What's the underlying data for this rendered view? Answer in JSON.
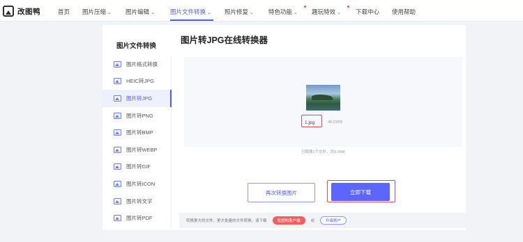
{
  "app": {
    "logo_text": "改图鸭"
  },
  "nav": {
    "items": [
      {
        "label": "首页"
      },
      {
        "label": "图片压缩",
        "caret": "⌄"
      },
      {
        "label": "图片编辑",
        "caret": "⌄"
      },
      {
        "label": "图片文件转换",
        "caret": "⌄"
      },
      {
        "label": "照片修复",
        "caret": "⌄"
      },
      {
        "label": "特色功能",
        "caret": "⌄"
      },
      {
        "label": "趣玩特效",
        "caret": "⌄"
      },
      {
        "label": "下载中心"
      },
      {
        "label": "使用帮助"
      }
    ],
    "active_index": 3
  },
  "sidebar": {
    "title": "图片文件转换",
    "items": [
      {
        "label": "图片格式转换",
        "icon": "image-icon"
      },
      {
        "label": "HEIC转JPG",
        "icon": "image-icon"
      },
      {
        "label": "图片转JPG",
        "icon": "image-icon"
      },
      {
        "label": "图片转PNG",
        "icon": "image-icon"
      },
      {
        "label": "图片转BMP",
        "icon": "image-icon"
      },
      {
        "label": "图片转WEBP",
        "icon": "image-icon"
      },
      {
        "label": "图片转GIF",
        "icon": "image-icon"
      },
      {
        "label": "图片转ICON",
        "icon": "image-icon"
      },
      {
        "label": "图片转文字",
        "icon": "image-icon"
      },
      {
        "label": "图片转PDF",
        "icon": "image-icon"
      }
    ],
    "active_index": 2
  },
  "main": {
    "title": "图片转JPG在线转换器",
    "file": {
      "name": "1.jpg",
      "size": "46.01KB"
    },
    "summary": "已转换1个文件，共0.05M",
    "again_button": "再次转换图片",
    "download_button": "立即下载"
  },
  "promo": {
    "text": "转换更大的文件、更大批量的文件转换，请下载",
    "client_button": "改图鸭客户端",
    "or_text": "或",
    "upgrade_button": "升级账户"
  },
  "colors": {
    "accent": "#4e5bff",
    "highlight": "#e5484d",
    "promo_red": "#ff5a5f"
  }
}
